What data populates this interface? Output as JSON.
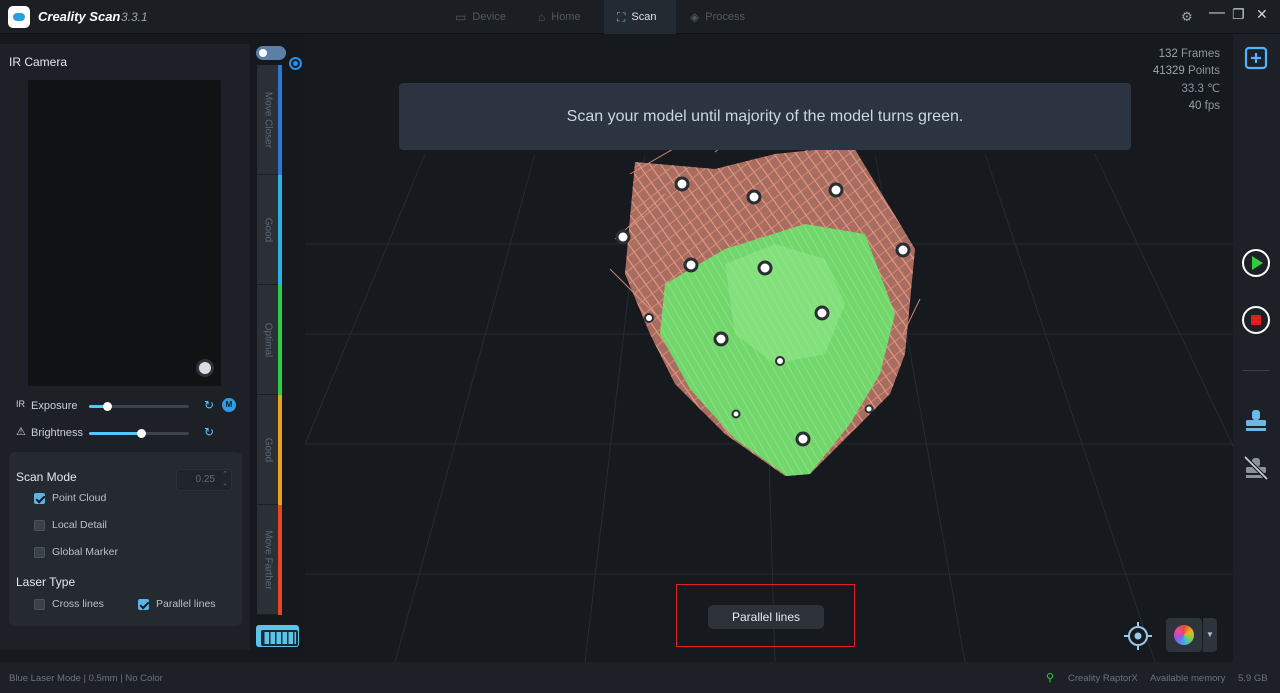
{
  "titlebar": {
    "app_name": "Creality Scan",
    "version": "3.3.1",
    "tabs": [
      {
        "label": "Device",
        "icon": "device-icon"
      },
      {
        "label": "Home",
        "icon": "home-icon"
      },
      {
        "label": "Scan",
        "icon": "scan-icon",
        "active": true
      },
      {
        "label": "Process",
        "icon": "process-icon"
      }
    ]
  },
  "left_panel": {
    "camera_title": "IR Camera",
    "exposure": {
      "prefix": "IR",
      "label": "Exposure",
      "level": 0.18,
      "mode_badge": "M"
    },
    "brightness": {
      "label": "Brightness",
      "level": 0.52
    },
    "scan_mode": {
      "title": "Scan Mode",
      "options": [
        {
          "label": "Point Cloud",
          "checked": true
        },
        {
          "label": "Local Detail",
          "checked": false
        },
        {
          "label": "Global Marker",
          "checked": false
        }
      ],
      "detail_value": "0.25"
    },
    "laser_type": {
      "title": "Laser Type",
      "options": [
        {
          "label": "Cross lines",
          "checked": false
        },
        {
          "label": "Parallel lines",
          "checked": true
        }
      ]
    }
  },
  "distance_gauge": {
    "segments": [
      {
        "label": "Move Closer",
        "color": "#2a78d6"
      },
      {
        "label": "Good",
        "color": "#27b3e6"
      },
      {
        "label": "Optimal",
        "color": "#2ecc40"
      },
      {
        "label": "Good",
        "color": "#e8a21e"
      },
      {
        "label": "Move Farther",
        "color": "#e8471e"
      }
    ]
  },
  "viewport": {
    "hint": "Scan your model until majority of the model turns green.",
    "stats": {
      "frames_value": "132",
      "frames_label": "Frames",
      "points_value": "41329",
      "points_label": "Points",
      "temperature": "33.3 ℃",
      "fps_value": "40",
      "fps_label": "fps"
    },
    "laser_mode_label": "Parallel lines"
  },
  "statusbar": {
    "mode_info": "Blue Laser Mode | 0.5mm | No Color",
    "device_name": "Creality RaptorX",
    "memory_label": "Available memory",
    "memory_value": "5.9 GB"
  },
  "colors": {
    "accent": "#2f9de0",
    "play": "#2ecc40",
    "stop": "#e02020",
    "highlight_box": "#e02020"
  }
}
